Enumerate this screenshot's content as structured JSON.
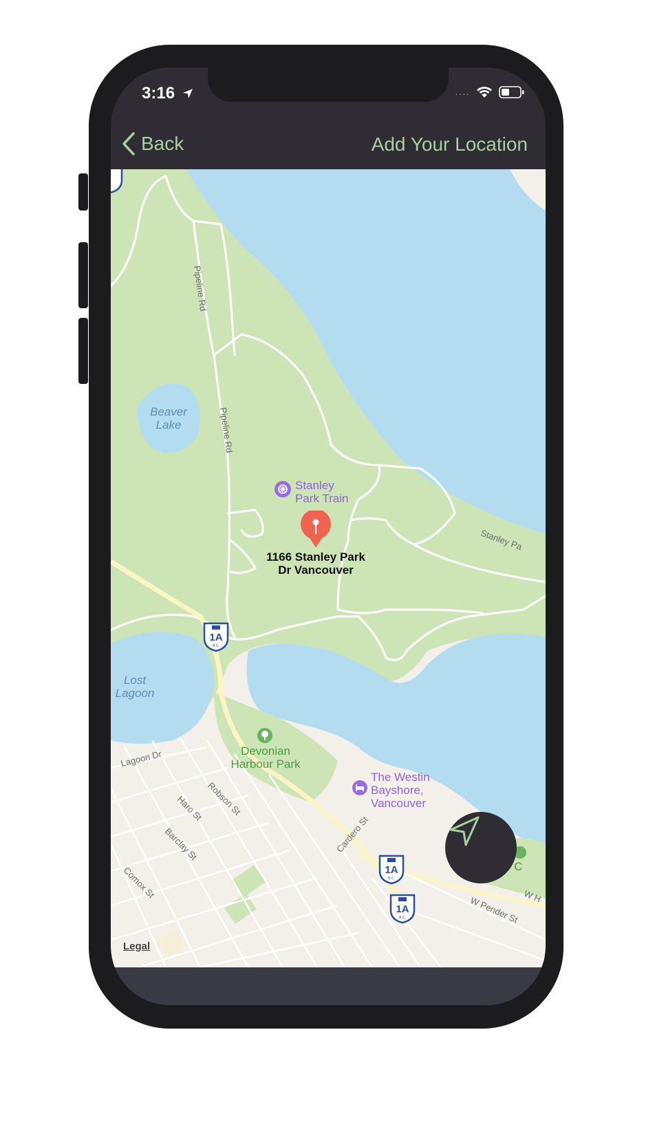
{
  "status_bar": {
    "time": "3:16",
    "signal_dots": "....",
    "icons": [
      "location-arrow-icon",
      "wifi-icon",
      "battery-icon"
    ]
  },
  "navbar": {
    "back_label": "Back",
    "title": "Add Your Location"
  },
  "map": {
    "pin_label": "1166 Stanley Park\nDr Vancouver",
    "water_labels": {
      "beaver_lake": "Beaver\nLake",
      "lost_lagoon": "Lost\nLagoon"
    },
    "road_labels": {
      "pipeline_rd_1": "Pipeline Rd",
      "pipeline_rd_2": "Pipeline Rd",
      "stanley_park_dr": "Stanley Pa",
      "lagoon_dr": "Lagoon Dr",
      "robson_st": "Robson St",
      "haro_st": "Haro St",
      "barclay_st": "Barclay St",
      "comox_st": "Comox St",
      "cardero_st": "Cardero St",
      "w_pender_st": "W Pender St",
      "w_h": "W H"
    },
    "pois": {
      "stanley_park_train": "Stanley\nPark Train",
      "devonian_harbour_park": "Devonian\nHarbour Park",
      "westin_bayshore": "The Westin\nBayshore,\nVancouver",
      "harbour": "Harbour C"
    },
    "highway_shield": "1A",
    "highway_shield_sub": "B.C.",
    "legal": "Legal",
    "colors": {
      "park": "#cde5b6",
      "water": "#b4dcf0",
      "land": "#f3f0ea",
      "road": "#ffffff",
      "highway": "#fbf4c4",
      "pin": "#ef6451"
    }
  },
  "locate_button": {
    "icon": "navigation-arrow-icon"
  }
}
